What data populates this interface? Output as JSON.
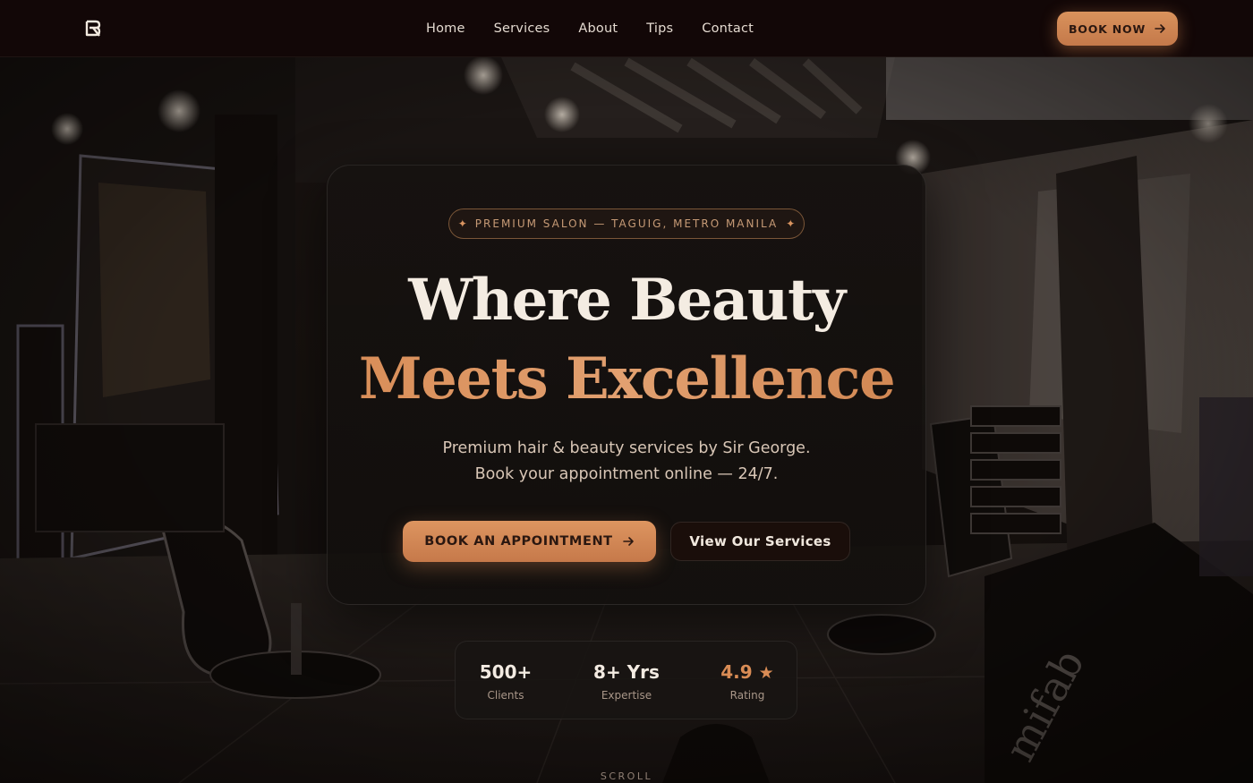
{
  "brand": {
    "logo_icon": "brand-monogram-icon"
  },
  "nav": {
    "links": [
      "Home",
      "Services",
      "About",
      "Tips",
      "Contact"
    ],
    "cta_label": "BOOK NOW",
    "cta_icon": "arrow-right-icon"
  },
  "hero": {
    "badge_text": "PREMIUM SALON — TAGUIG, METRO MANILA",
    "badge_icon": "sparkle-icon",
    "headline_line1": "Where Beauty",
    "headline_line2": "Meets Excellence",
    "subtitle_line1": "Premium hair & beauty services by Sir George.",
    "subtitle_line2": "Book your appointment online — 24/7.",
    "primary_button": "BOOK AN APPOINTMENT",
    "secondary_button": "View Our Services"
  },
  "stats": [
    {
      "value": "500+",
      "label": "Clients"
    },
    {
      "value": "8+ Yrs",
      "label": "Expertise"
    },
    {
      "value": "4.9",
      "label": "Rating",
      "icon": "star-icon"
    }
  ],
  "scroll_label": "SCROLL",
  "colors": {
    "accent": "#d38a56",
    "nav_bg": "#120707",
    "card_bg": "#161210",
    "text_light": "#f4ece2"
  }
}
